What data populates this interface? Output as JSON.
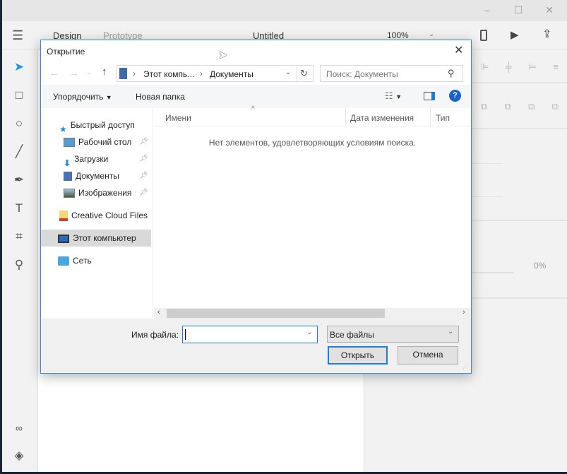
{
  "app": {
    "tabs": [
      "Design",
      "Prototype"
    ],
    "document_title": "Untitled",
    "zoom": "100%",
    "opacity": "0%"
  },
  "dialog": {
    "title": "Открытие",
    "breadcrumb": [
      "Этот компь...",
      "Документы"
    ],
    "search_placeholder": "Поиск: Документы",
    "organize_label": "Упорядочить",
    "new_folder_label": "Новая папка",
    "columns": [
      "Имени",
      "Дата изменения",
      "Тип"
    ],
    "empty_message": "Нет элементов, удовлетворяющих условиям поиска.",
    "nav": [
      {
        "label": "Быстрый доступ"
      },
      {
        "label": "Рабочий стол"
      },
      {
        "label": "Загрузки"
      },
      {
        "label": "Документы"
      },
      {
        "label": "Изображения"
      },
      {
        "label": "Creative Cloud Files"
      },
      {
        "label": "Этот компьютер"
      },
      {
        "label": "Сеть"
      }
    ],
    "filename_label": "Имя файла:",
    "filename_value": "",
    "filter_value": "Все файлы",
    "open_label": "Открыть",
    "cancel_label": "Отмена"
  },
  "colors": {
    "accent": "#1c97ea",
    "dialog_border": "#3a8ad6",
    "selected_nav": "#d9d9d9"
  }
}
